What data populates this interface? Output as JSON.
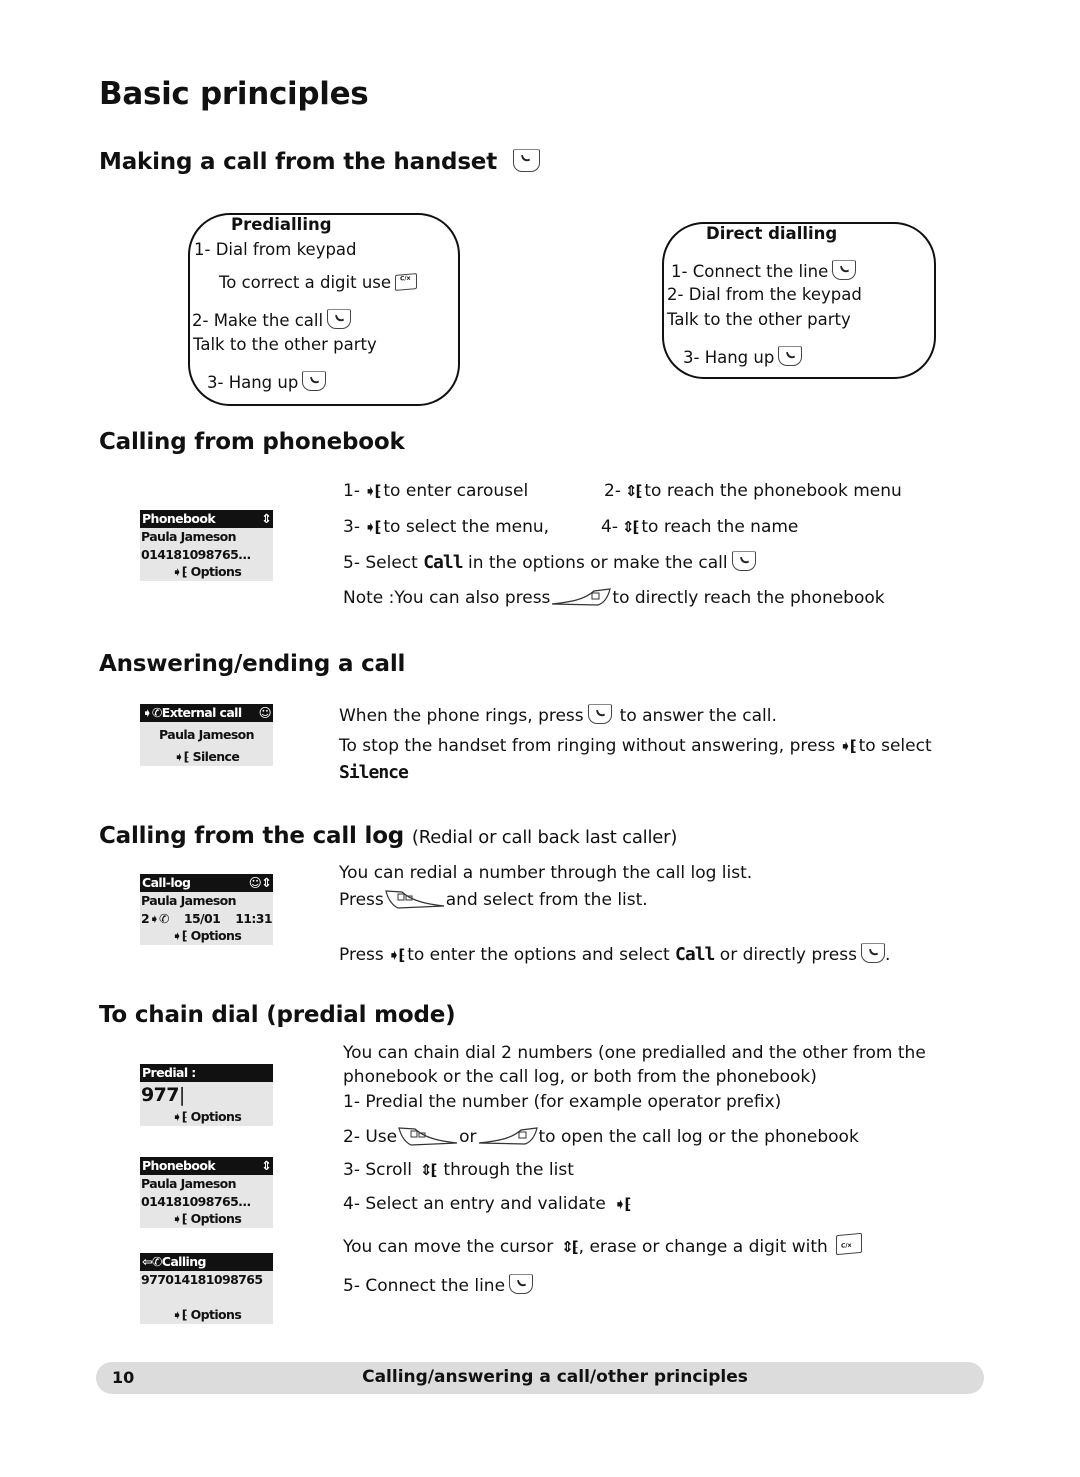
{
  "page": {
    "title": "Basic principles",
    "footer": {
      "page_number": "10",
      "chapter": "Calling/answering a call/other principles"
    }
  },
  "icons": {
    "talk_key": "phone-handset-key-icon",
    "clear_key": "c-x-clear-key-icon",
    "ok_key": "navigation-ok-right-icon",
    "updown_key": "navigation-up-down-icon",
    "right_soft_key": "phonebook-soft-key-icon",
    "left_soft_key": "call-log-soft-key-icon"
  },
  "making_call": {
    "heading": "Making a call from the handset",
    "predialling": {
      "title": "Predialling",
      "lines": [
        "1- Dial from keypad",
        "To correct a digit use",
        "2- Make the call",
        "Talk to the other party",
        "3- Hang up"
      ]
    },
    "direct": {
      "title": "Direct dialling",
      "lines": [
        "1- Connect the line",
        "2- Dial from the keypad",
        "Talk to the other party",
        "3- Hang up"
      ]
    }
  },
  "phonebook": {
    "heading": "Calling from phonebook",
    "screen": {
      "title": "Phonebook",
      "name": "Paula Jameson",
      "number": "014181098765...",
      "softkey": "Options"
    },
    "steps": {
      "s1_num": "1-",
      "s1_text": "to enter carousel",
      "s2_num": "2-",
      "s2_text": "to reach the phonebook menu",
      "s3_num": "3-",
      "s3_text": "to select the menu,",
      "s4_num": "4-",
      "s4_text": "to reach the name",
      "s5_pre": "5- Select",
      "s5_word": "Call",
      "s5_post": "in the options or make the call",
      "note_pre": "Note :You can also press",
      "note_post": "to directly reach the phonebook"
    }
  },
  "answering": {
    "heading": "Answering/ending a call",
    "screen": {
      "title": "External call",
      "name": "Paula Jameson",
      "softkey": "Silence"
    },
    "line1_pre": "When the phone rings, press",
    "line1_post": "to answer the call.",
    "line2_pre": "To stop the handset from ringing without answering, press",
    "line2_post": "to  select",
    "line3_word": "Silence"
  },
  "call_log": {
    "heading": "Calling from the call log",
    "subheading": "(Redial or call back last caller)",
    "screen": {
      "title": "Call-log",
      "name": "Paula Jameson",
      "count": "2",
      "date": "15/01",
      "time": "11:31",
      "softkey": "Options"
    },
    "line1": "You can redial a number through the call log list.",
    "line2_pre": "Press",
    "line2_post": "and select from the list.",
    "line3_pre": "Press",
    "line3_mid": "to enter the options and select",
    "line3_word": "Call",
    "line3_post": "or directly press",
    "line3_end": "."
  },
  "chain_dial": {
    "heading": "To chain dial (predial mode)",
    "screen_predial": {
      "title": "Predial :",
      "value": "977",
      "softkey": "Options"
    },
    "screen_phonebook": {
      "title": "Phonebook",
      "name": "Paula Jameson",
      "number": "014181098765...",
      "softkey": "Options"
    },
    "screen_calling": {
      "title": "Calling",
      "number": "977014181098765",
      "softkey": "Options"
    },
    "intro1": "You can chain dial 2 numbers (one predialled and the other from the",
    "intro2": "phonebook or the call log, or both from the phonebook)",
    "step1": "1- Predial the number (for example operator prefix)",
    "step2_pre": "2- Use",
    "step2_mid": "or",
    "step2_post": "to open the call log or the phonebook",
    "step3_pre": "3- Scroll",
    "step3_post": "through the list",
    "step4": "4- Select an entry and validate",
    "cursor_pre": "You can move the cursor",
    "cursor_post": ", erase or change a digit with",
    "step5": "5- Connect the line"
  }
}
